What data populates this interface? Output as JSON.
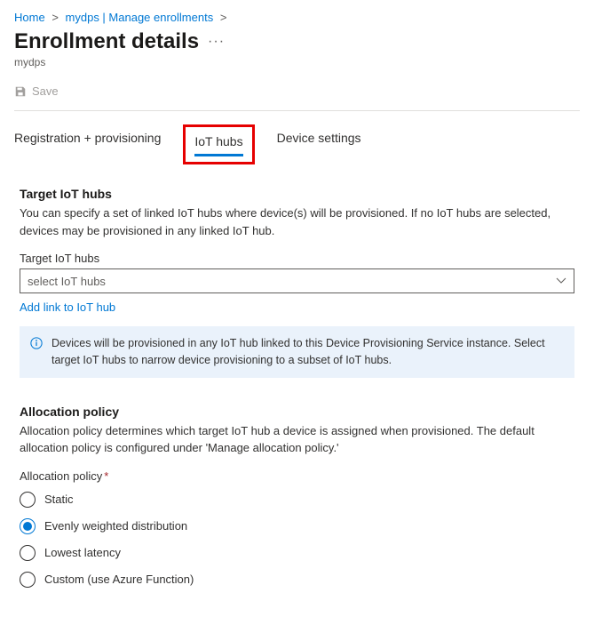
{
  "breadcrumb": {
    "home": "Home",
    "parent": "mydps | Manage enrollments"
  },
  "header": {
    "title": "Enrollment details",
    "subtitle": "mydps"
  },
  "toolbar": {
    "save_label": "Save"
  },
  "tabs": [
    {
      "label": "Registration + provisioning"
    },
    {
      "label": "IoT hubs"
    },
    {
      "label": "Device settings"
    }
  ],
  "target_hubs": {
    "heading": "Target IoT hubs",
    "description": "You can specify a set of linked IoT hubs where device(s) will be provisioned. If no IoT hubs are selected, devices may be provisioned in any linked IoT hub.",
    "field_label": "Target IoT hubs",
    "dropdown_placeholder": "select IoT hubs",
    "add_link": "Add link to IoT hub",
    "info_text": "Devices will be provisioned in any IoT hub linked to this Device Provisioning Service instance. Select target IoT hubs to narrow device provisioning to a subset of IoT hubs."
  },
  "allocation": {
    "heading": "Allocation policy",
    "description": "Allocation policy determines which target IoT hub a device is assigned when provisioned. The default allocation policy is configured under 'Manage allocation policy.'",
    "field_label": "Allocation policy",
    "options": [
      {
        "label": "Static"
      },
      {
        "label": "Evenly weighted distribution"
      },
      {
        "label": "Lowest latency"
      },
      {
        "label": "Custom (use Azure Function)"
      }
    ],
    "selected_index": 1
  }
}
